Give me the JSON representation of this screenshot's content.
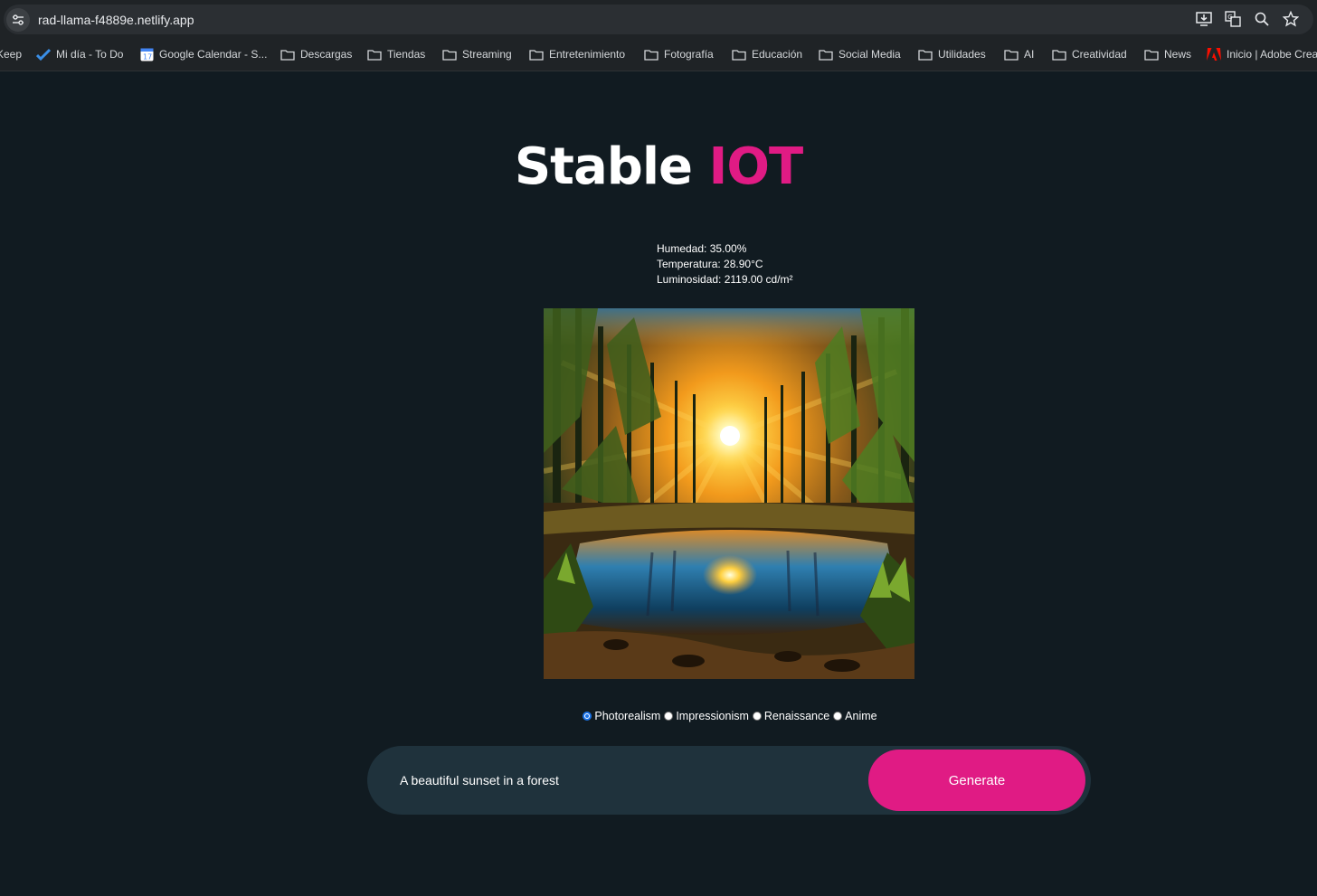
{
  "browser": {
    "url": "rad-llama-f4889e.netlify.app",
    "bookmarks": [
      {
        "label": "Keep",
        "icon": "keep-icon"
      },
      {
        "label": "Mi día - To Do",
        "icon": "todo-icon"
      },
      {
        "label": "Google Calendar - S...",
        "icon": "calendar-icon"
      },
      {
        "label": "Descargas",
        "icon": "folder-icon"
      },
      {
        "label": "Tiendas",
        "icon": "folder-icon"
      },
      {
        "label": "Streaming",
        "icon": "folder-icon"
      },
      {
        "label": "Entretenimiento",
        "icon": "folder-icon"
      },
      {
        "label": "Fotografía",
        "icon": "folder-icon"
      },
      {
        "label": "Educación",
        "icon": "folder-icon"
      },
      {
        "label": "Social Media",
        "icon": "folder-icon"
      },
      {
        "label": "Utilidades",
        "icon": "folder-icon"
      },
      {
        "label": "AI",
        "icon": "folder-icon"
      },
      {
        "label": "Creatividad",
        "icon": "folder-icon"
      },
      {
        "label": "News",
        "icon": "folder-icon"
      },
      {
        "label": "Inicio | Adobe Crea",
        "icon": "adobe-icon"
      }
    ]
  },
  "app": {
    "title_main": "Stable",
    "title_accent": "IOT",
    "accent_color": "#e01b84"
  },
  "sensors": {
    "humidity": "Humedad: 35.00%",
    "temperature": "Temperatura: 28.90°C",
    "luminosity": "Luminosidad: 2119.00 cd/m²"
  },
  "styles": {
    "options": [
      "Photorealism",
      "Impressionism",
      "Renaissance",
      "Anime"
    ],
    "selected": "Photorealism"
  },
  "prompt": {
    "value": "A beautiful sunset in a forest",
    "button_label": "Generate"
  }
}
